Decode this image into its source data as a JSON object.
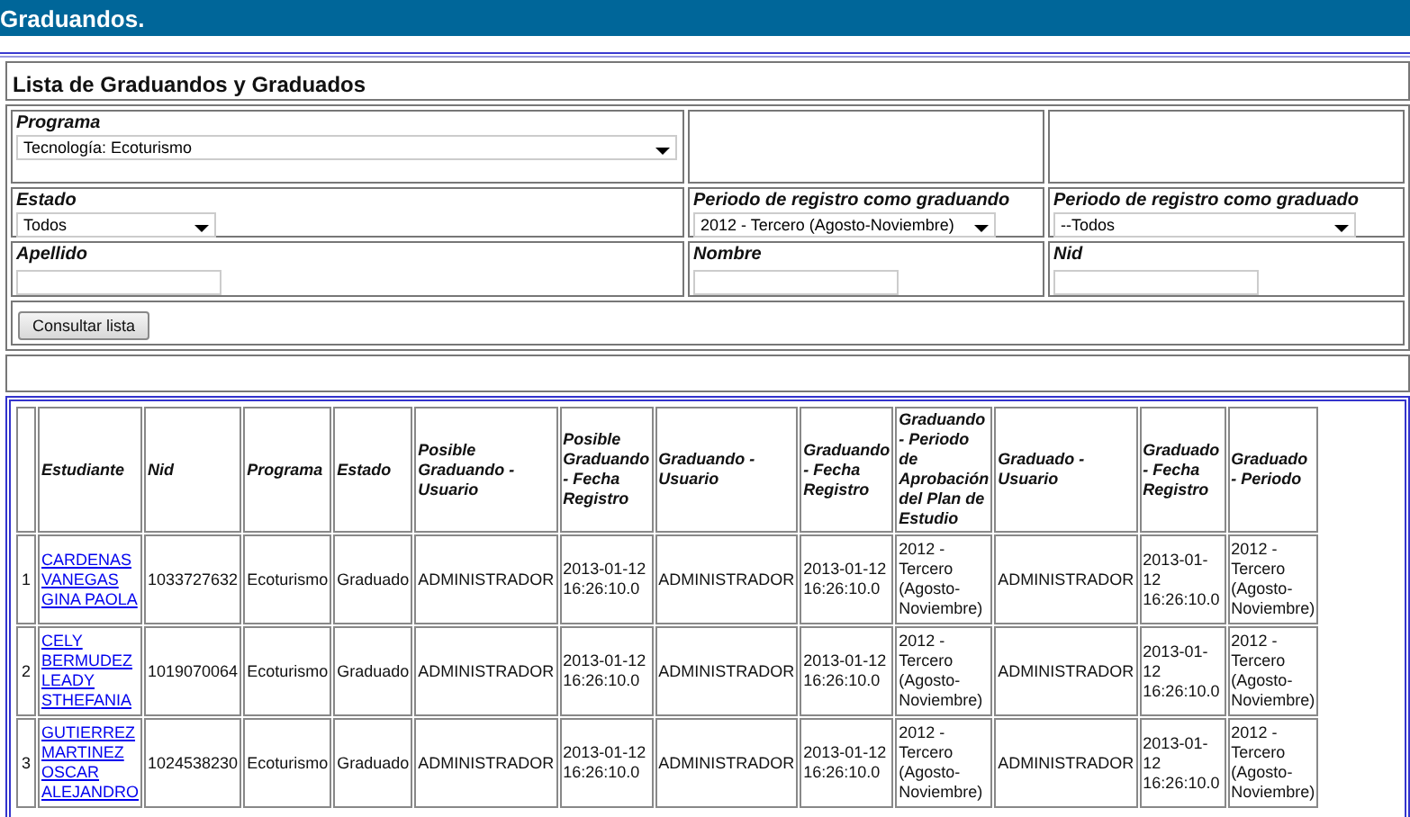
{
  "header": {
    "title": "Graduandos."
  },
  "section_title": "Lista de Graduandos y Graduados",
  "filters": [
    {
      "kind": "select",
      "label": "Programa",
      "value": "Tecnología: Ecoturismo"
    },
    {
      "kind": "empty"
    },
    {
      "kind": "empty"
    },
    {
      "kind": "select",
      "label": "Estado",
      "value": "Todos"
    },
    {
      "kind": "select",
      "label": "Periodo de registro como graduando",
      "value": "2012 - Tercero (Agosto-Noviembre)"
    },
    {
      "kind": "select",
      "label": "Periodo de registro como graduado",
      "value": "--Todos"
    },
    {
      "kind": "text",
      "label": "Apellido"
    },
    {
      "kind": "text",
      "label": "Nombre"
    },
    {
      "kind": "text",
      "label": "Nid"
    }
  ],
  "submit_button": "Consultar lista",
  "table": {
    "columns": [
      "",
      "Estudiante",
      "Nid",
      "Programa",
      "Estado",
      "Posible Graduando - Usuario",
      "Posible Graduando - Fecha Registro",
      "Graduando - Usuario",
      "Graduando - Fecha Registro",
      "Graduando - Periodo de Aprobación del Plan de Estudio",
      "Graduado - Usuario",
      "Graduado - Fecha Registro",
      "Graduado - Periodo"
    ],
    "rows": [
      [
        "1",
        "CARDENAS VANEGAS GINA PAOLA",
        "1033727632",
        "Ecoturismo",
        "Graduado",
        "ADMINISTRADOR",
        "2013-01-12 16:26:10.0",
        "ADMINISTRADOR",
        "2013-01-12 16:26:10.0",
        "2012 - Tercero (Agosto-Noviembre)",
        "ADMINISTRADOR",
        "2013-01-12 16:26:10.0",
        "2012 - Tercero (Agosto-Noviembre)"
      ],
      [
        "2",
        "CELY BERMUDEZ LEADY STHEFANIA",
        "1019070064",
        "Ecoturismo",
        "Graduado",
        "ADMINISTRADOR",
        "2013-01-12 16:26:10.0",
        "ADMINISTRADOR",
        "2013-01-12 16:26:10.0",
        "2012 - Tercero (Agosto-Noviembre)",
        "ADMINISTRADOR",
        "2013-01-12 16:26:10.0",
        "2012 - Tercero (Agosto-Noviembre)"
      ],
      [
        "3",
        "GUTIERREZ MARTINEZ OSCAR ALEJANDRO",
        "1024538230",
        "Ecoturismo",
        "Graduado",
        "ADMINISTRADOR",
        "2013-01-12 16:26:10.0",
        "ADMINISTRADOR",
        "2013-01-12 16:26:10.0",
        "2012 - Tercero (Agosto-Noviembre)",
        "ADMINISTRADOR",
        "2013-01-12 16:26:10.0",
        "2012 - Tercero (Agosto-Noviembre)"
      ]
    ]
  }
}
